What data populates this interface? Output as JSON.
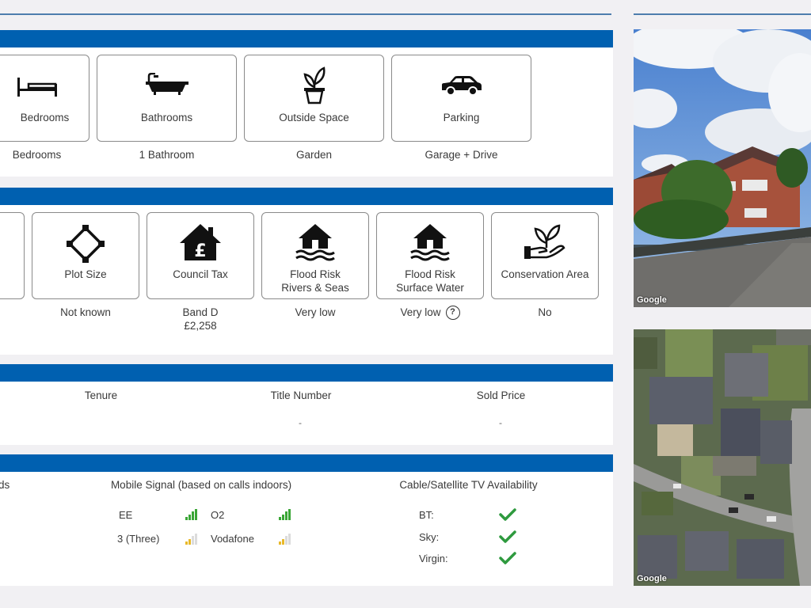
{
  "features": {
    "tiles": [
      {
        "label": "Bedrooms",
        "value": "Bedrooms",
        "icon": "bed-icon"
      },
      {
        "label": "Bathrooms",
        "value": "1 Bathroom",
        "icon": "bath-icon"
      },
      {
        "label": "Outside Space",
        "value": "Garden",
        "icon": "plant-pot-icon"
      },
      {
        "label": "Parking",
        "value": "Garage + Drive",
        "icon": "car-icon"
      }
    ]
  },
  "details": {
    "tiles": [
      {
        "label": "Plot Size",
        "value": "Not known",
        "icon": "diamond-plot-icon"
      },
      {
        "label": "Council Tax",
        "value": "Band D",
        "value2": "£2,258",
        "icon": "house-pound-icon"
      },
      {
        "label": "Flood Risk",
        "label2": "Rivers & Seas",
        "value": "Very low",
        "icon": "flood-house-icon"
      },
      {
        "label": "Flood Risk",
        "label2": "Surface Water",
        "value": "Very low",
        "icon": "flood-house-icon"
      },
      {
        "label": "Conservation Area",
        "value": "No",
        "icon": "hand-plant-icon"
      }
    ],
    "help_symbol": "?"
  },
  "ownership": {
    "columns": [
      {
        "header": "Tenure",
        "value": ""
      },
      {
        "header": "Title Number",
        "value": "-"
      },
      {
        "header": "Sold Price",
        "value": "-"
      }
    ]
  },
  "utilities": {
    "broadband_header_fragment": "ds",
    "mobile_header": "Mobile Signal (based on calls indoors)",
    "mobile": [
      {
        "name": "EE",
        "signal": 4,
        "color": "#3aa636"
      },
      {
        "name": "O2",
        "signal": 4,
        "color": "#3aa636"
      },
      {
        "name": "3 (Three)",
        "signal": 2,
        "color": "#e8b92a"
      },
      {
        "name": "Vodafone",
        "signal": 2,
        "color": "#e8b92a"
      }
    ],
    "tv_header": "Cable/Satellite TV Availability",
    "tv": [
      {
        "name": "BT:",
        "available": true
      },
      {
        "name": "Sky:",
        "available": true
      },
      {
        "name": "Virgin:",
        "available": true
      }
    ]
  },
  "images": {
    "street_view_credit": "Google",
    "aerial_credit": "Google"
  },
  "colors": {
    "band": "#0060b0",
    "signal_good": "#3aa636",
    "signal_fair": "#e8b92a",
    "check": "#2e9a3e"
  }
}
